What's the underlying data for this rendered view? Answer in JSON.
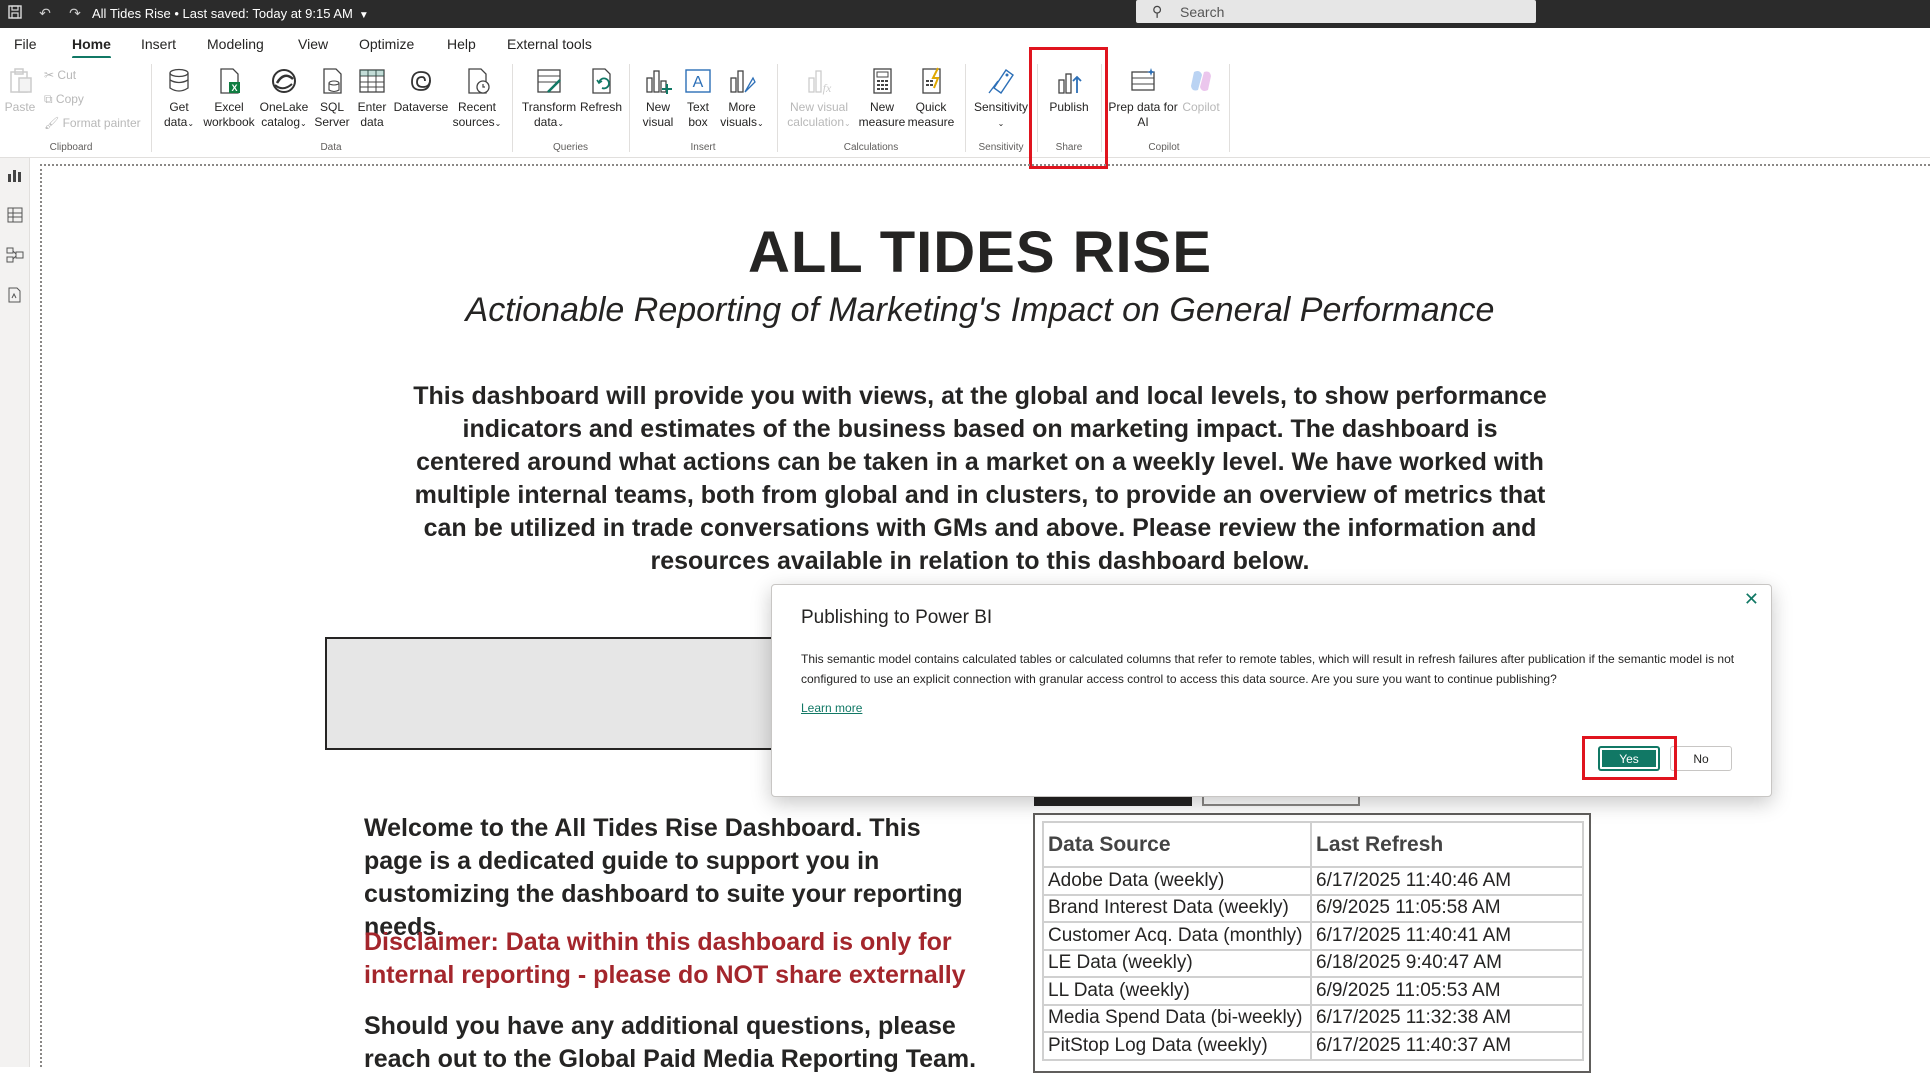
{
  "titlebar": {
    "doc_title": "All Tides Rise • Last saved: Today at 9:15 AM",
    "search_placeholder": "Search"
  },
  "menu": [
    "File",
    "Home",
    "Insert",
    "Modeling",
    "View",
    "Optimize",
    "Help",
    "External tools"
  ],
  "ribbon": {
    "clipboard": {
      "paste": "Paste",
      "cut": "Cut",
      "copy": "Copy",
      "format_painter": "Format painter",
      "group": "Clipboard"
    },
    "data": {
      "get_data": [
        "Get",
        "data"
      ],
      "excel": [
        "Excel",
        "workbook"
      ],
      "onelake": [
        "OneLake",
        "catalog"
      ],
      "sql": [
        "SQL",
        "Server"
      ],
      "enter": [
        "Enter",
        "data"
      ],
      "dataverse": [
        "Dataverse"
      ],
      "recent": [
        "Recent",
        "sources"
      ],
      "group": "Data"
    },
    "queries": {
      "transform": [
        "Transform",
        "data"
      ],
      "refresh": [
        "Refresh"
      ],
      "group": "Queries"
    },
    "insert": {
      "new_visual": [
        "New",
        "visual"
      ],
      "text_box": [
        "Text",
        "box"
      ],
      "more_visuals": [
        "More",
        "visuals"
      ],
      "group": "Insert"
    },
    "calculations": {
      "new_visual_calc": [
        "New visual",
        "calculation"
      ],
      "new_measure": [
        "New",
        "measure"
      ],
      "quick_measure": [
        "Quick",
        "measure"
      ],
      "group": "Calculations"
    },
    "sensitivity": {
      "label": [
        "Sensitivity"
      ],
      "group": "Sensitivity"
    },
    "share": {
      "publish": [
        "Publish"
      ],
      "group": "Share"
    },
    "copilot": {
      "prep": [
        "Prep data for",
        "AI"
      ],
      "copilot": [
        "Copilot"
      ],
      "group": "Copilot"
    },
    "accent_color": "#117865",
    "highlight_color": "#e0141e"
  },
  "report": {
    "title": "ALL TIDES RISE",
    "subtitle": "Actionable Reporting of Marketing's Impact on General Performance",
    "intro": "This dashboard will provide you with views, at the global and local levels, to show performance indicators and estimates of the business based on marketing impact. The dashboard is centered around what actions can be taken in a market on a weekly level. We have worked with multiple internal teams, both from global and in clusters, to provide an overview of metrics that can be utilized in trade conversations with GMs and above. Please review the information and resources available in relation to this dashboard below.",
    "welcome": "Welcome to the All Tides Rise Dashboard. This page is a dedicated guide to support you in customizing the dashboard to suite your reporting needs.",
    "disclaimer": "Disclaimer: Data within this dashboard is only for internal reporting - please do NOT share externally",
    "questions": "Should you have any additional questions, please reach out to the Global Paid Media Reporting Team.",
    "disclaimer_color": "#a4262c"
  },
  "refresh_table": {
    "headers": [
      "Data Source",
      "Last Refresh"
    ],
    "rows": [
      [
        "Adobe Data (weekly)",
        "6/17/2025 11:40:46 AM"
      ],
      [
        "Brand Interest Data (weekly)",
        "6/9/2025 11:05:58 AM"
      ],
      [
        "Customer Acq. Data (monthly)",
        "6/17/2025 11:40:41 AM"
      ],
      [
        "LE Data (weekly)",
        "6/18/2025 9:40:47 AM"
      ],
      [
        "LL Data (weekly)",
        "6/9/2025 11:05:53 AM"
      ],
      [
        "Media Spend Data (bi-weekly)",
        "6/17/2025 11:32:38 AM"
      ],
      [
        "PitStop Log Data (weekly)",
        "6/17/2025 11:40:37 AM"
      ]
    ]
  },
  "dialog": {
    "title": "Publishing to Power BI",
    "body": "This semantic model contains calculated tables or calculated columns that refer to remote tables, which will result in refresh failures after publication if the semantic model is not configured to use an explicit connection with granular access control to access this data source. Are you sure you want to continue publishing?",
    "learn_more": "Learn more",
    "yes": "Yes",
    "no": "No"
  }
}
